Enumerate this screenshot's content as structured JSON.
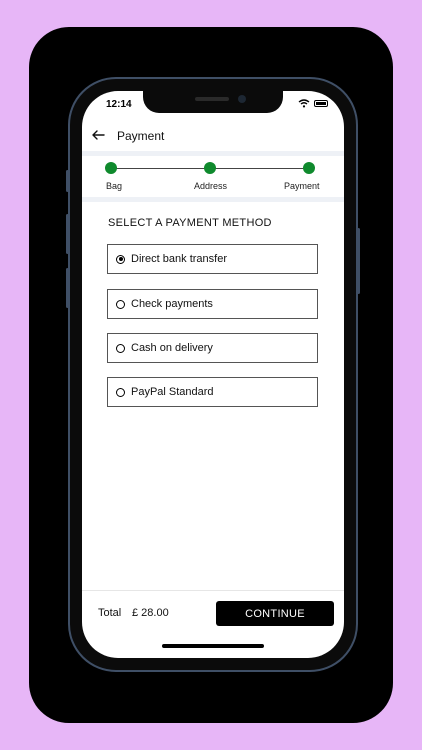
{
  "status_bar": {
    "time": "12:14"
  },
  "header": {
    "title": "Payment"
  },
  "stepper": {
    "steps": [
      {
        "label": "Bag"
      },
      {
        "label": "Address"
      },
      {
        "label": "Payment"
      }
    ],
    "active_color": "#0f8a2d"
  },
  "payment": {
    "section_title": "SELECT A PAYMENT METHOD",
    "options": [
      {
        "label": "Direct bank transfer",
        "selected": true
      },
      {
        "label": "Check payments",
        "selected": false
      },
      {
        "label": "Cash on delivery",
        "selected": false
      },
      {
        "label": "PayPal Standard",
        "selected": false
      }
    ]
  },
  "footer": {
    "total_label": "Total",
    "total_value": "£ 28.00",
    "continue_label": "CONTINUE"
  },
  "colors": {
    "background": "#e7b6f7",
    "card": "#000000",
    "accent": "#0f8a2d",
    "button": "#000000"
  }
}
